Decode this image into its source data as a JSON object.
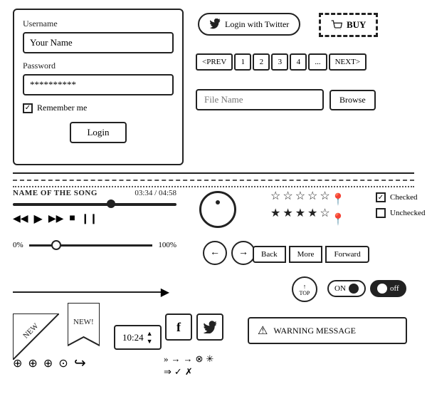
{
  "login": {
    "username_label": "Username",
    "username_placeholder": "Your Name",
    "password_label": "Password",
    "password_value": "**********",
    "remember_label": "Remember me",
    "login_btn": "Login"
  },
  "twitter": {
    "btn_label": "Login with Twitter"
  },
  "buy": {
    "btn_label": "BUY"
  },
  "pagination": {
    "prev": "<PREV",
    "pages": [
      "1",
      "2",
      "3",
      "4",
      "..."
    ],
    "next": "NEXT>"
  },
  "file": {
    "placeholder": "File Name",
    "browse_btn": "Browse"
  },
  "music": {
    "song_name": "NAME of THE SONG",
    "time": "03:34 / 04:58",
    "controls": [
      "◀◀",
      "▶",
      "▶▶",
      "■",
      "❙❙"
    ],
    "vol_min": "0%",
    "vol_max": "100%"
  },
  "nav": {
    "back": "Back",
    "more": "More",
    "forward": "Forward"
  },
  "top_btn": {
    "arrow": "↑",
    "label": "TOP"
  },
  "toggle": {
    "on_label": "ON",
    "off_label": "off"
  },
  "new_badges": {
    "label1": "NEW",
    "label2": "NEW!"
  },
  "time_display": "10:24",
  "warning": {
    "label": "WARNING MESSAGE"
  },
  "check": {
    "checked_label": "Checked",
    "unchecked_label": "Unchecked"
  },
  "dividers": {
    "solid": "—",
    "dashed": "- - -",
    "dotted": "·····"
  }
}
